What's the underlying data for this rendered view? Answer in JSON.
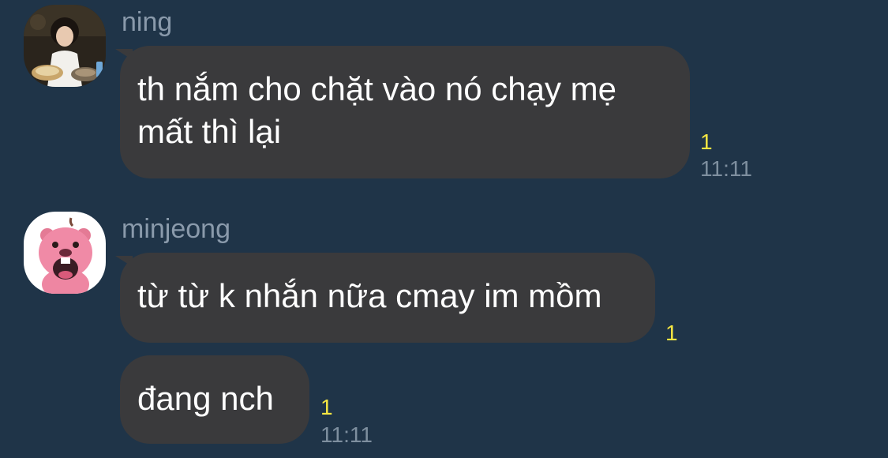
{
  "colors": {
    "background": "#1f3448",
    "bubble": "#3a3a3c",
    "bubble_text": "#ffffff",
    "sender_name": "#8a9aab",
    "unread_count": "#f5e642",
    "timestamp": "#7e8f9f"
  },
  "groups": [
    {
      "sender": "ning",
      "avatar_icon": "photo-avatar-icon",
      "messages": [
        {
          "lines": [
            "th nắm cho chặt vào nó chạy mẹ",
            "mất thì lại"
          ],
          "unread": "1",
          "time": "11:11"
        }
      ]
    },
    {
      "sender": "minjeong",
      "avatar_icon": "pink-beaver-avatar-icon",
      "messages": [
        {
          "lines": [
            "từ từ k nhắn nữa cmay im mồm"
          ],
          "unread": "1",
          "time": ""
        },
        {
          "lines": [
            "đang nch"
          ],
          "unread": "1",
          "time": "11:11"
        }
      ]
    }
  ]
}
